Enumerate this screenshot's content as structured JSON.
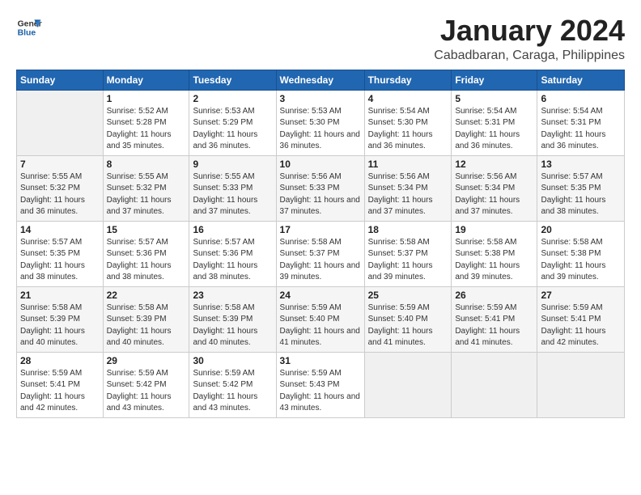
{
  "logo": {
    "text_general": "General",
    "text_blue": "Blue"
  },
  "title": "January 2024",
  "subtitle": "Cabadbaran, Caraga, Philippines",
  "header": {
    "days": [
      "Sunday",
      "Monday",
      "Tuesday",
      "Wednesday",
      "Thursday",
      "Friday",
      "Saturday"
    ]
  },
  "weeks": [
    [
      {
        "day": "",
        "sunrise": "",
        "sunset": "",
        "daylight": ""
      },
      {
        "day": "1",
        "sunrise": "Sunrise: 5:52 AM",
        "sunset": "Sunset: 5:28 PM",
        "daylight": "Daylight: 11 hours and 35 minutes."
      },
      {
        "day": "2",
        "sunrise": "Sunrise: 5:53 AM",
        "sunset": "Sunset: 5:29 PM",
        "daylight": "Daylight: 11 hours and 36 minutes."
      },
      {
        "day": "3",
        "sunrise": "Sunrise: 5:53 AM",
        "sunset": "Sunset: 5:30 PM",
        "daylight": "Daylight: 11 hours and 36 minutes."
      },
      {
        "day": "4",
        "sunrise": "Sunrise: 5:54 AM",
        "sunset": "Sunset: 5:30 PM",
        "daylight": "Daylight: 11 hours and 36 minutes."
      },
      {
        "day": "5",
        "sunrise": "Sunrise: 5:54 AM",
        "sunset": "Sunset: 5:31 PM",
        "daylight": "Daylight: 11 hours and 36 minutes."
      },
      {
        "day": "6",
        "sunrise": "Sunrise: 5:54 AM",
        "sunset": "Sunset: 5:31 PM",
        "daylight": "Daylight: 11 hours and 36 minutes."
      }
    ],
    [
      {
        "day": "7",
        "sunrise": "Sunrise: 5:55 AM",
        "sunset": "Sunset: 5:32 PM",
        "daylight": "Daylight: 11 hours and 36 minutes."
      },
      {
        "day": "8",
        "sunrise": "Sunrise: 5:55 AM",
        "sunset": "Sunset: 5:32 PM",
        "daylight": "Daylight: 11 hours and 37 minutes."
      },
      {
        "day": "9",
        "sunrise": "Sunrise: 5:55 AM",
        "sunset": "Sunset: 5:33 PM",
        "daylight": "Daylight: 11 hours and 37 minutes."
      },
      {
        "day": "10",
        "sunrise": "Sunrise: 5:56 AM",
        "sunset": "Sunset: 5:33 PM",
        "daylight": "Daylight: 11 hours and 37 minutes."
      },
      {
        "day": "11",
        "sunrise": "Sunrise: 5:56 AM",
        "sunset": "Sunset: 5:34 PM",
        "daylight": "Daylight: 11 hours and 37 minutes."
      },
      {
        "day": "12",
        "sunrise": "Sunrise: 5:56 AM",
        "sunset": "Sunset: 5:34 PM",
        "daylight": "Daylight: 11 hours and 37 minutes."
      },
      {
        "day": "13",
        "sunrise": "Sunrise: 5:57 AM",
        "sunset": "Sunset: 5:35 PM",
        "daylight": "Daylight: 11 hours and 38 minutes."
      }
    ],
    [
      {
        "day": "14",
        "sunrise": "Sunrise: 5:57 AM",
        "sunset": "Sunset: 5:35 PM",
        "daylight": "Daylight: 11 hours and 38 minutes."
      },
      {
        "day": "15",
        "sunrise": "Sunrise: 5:57 AM",
        "sunset": "Sunset: 5:36 PM",
        "daylight": "Daylight: 11 hours and 38 minutes."
      },
      {
        "day": "16",
        "sunrise": "Sunrise: 5:57 AM",
        "sunset": "Sunset: 5:36 PM",
        "daylight": "Daylight: 11 hours and 38 minutes."
      },
      {
        "day": "17",
        "sunrise": "Sunrise: 5:58 AM",
        "sunset": "Sunset: 5:37 PM",
        "daylight": "Daylight: 11 hours and 39 minutes."
      },
      {
        "day": "18",
        "sunrise": "Sunrise: 5:58 AM",
        "sunset": "Sunset: 5:37 PM",
        "daylight": "Daylight: 11 hours and 39 minutes."
      },
      {
        "day": "19",
        "sunrise": "Sunrise: 5:58 AM",
        "sunset": "Sunset: 5:38 PM",
        "daylight": "Daylight: 11 hours and 39 minutes."
      },
      {
        "day": "20",
        "sunrise": "Sunrise: 5:58 AM",
        "sunset": "Sunset: 5:38 PM",
        "daylight": "Daylight: 11 hours and 39 minutes."
      }
    ],
    [
      {
        "day": "21",
        "sunrise": "Sunrise: 5:58 AM",
        "sunset": "Sunset: 5:39 PM",
        "daylight": "Daylight: 11 hours and 40 minutes."
      },
      {
        "day": "22",
        "sunrise": "Sunrise: 5:58 AM",
        "sunset": "Sunset: 5:39 PM",
        "daylight": "Daylight: 11 hours and 40 minutes."
      },
      {
        "day": "23",
        "sunrise": "Sunrise: 5:58 AM",
        "sunset": "Sunset: 5:39 PM",
        "daylight": "Daylight: 11 hours and 40 minutes."
      },
      {
        "day": "24",
        "sunrise": "Sunrise: 5:59 AM",
        "sunset": "Sunset: 5:40 PM",
        "daylight": "Daylight: 11 hours and 41 minutes."
      },
      {
        "day": "25",
        "sunrise": "Sunrise: 5:59 AM",
        "sunset": "Sunset: 5:40 PM",
        "daylight": "Daylight: 11 hours and 41 minutes."
      },
      {
        "day": "26",
        "sunrise": "Sunrise: 5:59 AM",
        "sunset": "Sunset: 5:41 PM",
        "daylight": "Daylight: 11 hours and 41 minutes."
      },
      {
        "day": "27",
        "sunrise": "Sunrise: 5:59 AM",
        "sunset": "Sunset: 5:41 PM",
        "daylight": "Daylight: 11 hours and 42 minutes."
      }
    ],
    [
      {
        "day": "28",
        "sunrise": "Sunrise: 5:59 AM",
        "sunset": "Sunset: 5:41 PM",
        "daylight": "Daylight: 11 hours and 42 minutes."
      },
      {
        "day": "29",
        "sunrise": "Sunrise: 5:59 AM",
        "sunset": "Sunset: 5:42 PM",
        "daylight": "Daylight: 11 hours and 43 minutes."
      },
      {
        "day": "30",
        "sunrise": "Sunrise: 5:59 AM",
        "sunset": "Sunset: 5:42 PM",
        "daylight": "Daylight: 11 hours and 43 minutes."
      },
      {
        "day": "31",
        "sunrise": "Sunrise: 5:59 AM",
        "sunset": "Sunset: 5:43 PM",
        "daylight": "Daylight: 11 hours and 43 minutes."
      },
      {
        "day": "",
        "sunrise": "",
        "sunset": "",
        "daylight": ""
      },
      {
        "day": "",
        "sunrise": "",
        "sunset": "",
        "daylight": ""
      },
      {
        "day": "",
        "sunrise": "",
        "sunset": "",
        "daylight": ""
      }
    ]
  ]
}
